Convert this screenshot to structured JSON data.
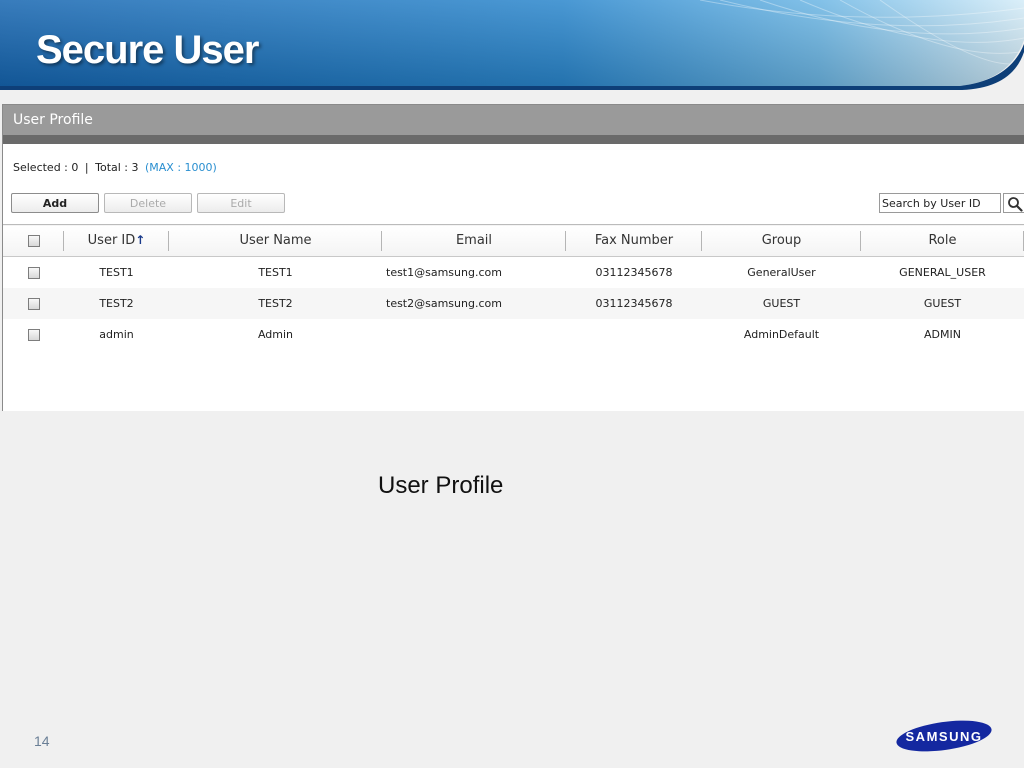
{
  "slide": {
    "title": "Secure User",
    "caption": "User Profile",
    "page_number": "14",
    "logo_text": "SAMSUNG"
  },
  "panel": {
    "title": "User Profile",
    "summary": {
      "selected": "Selected : 0",
      "separator": "|",
      "total": "Total : 3",
      "max": "(MAX : 1000)"
    },
    "buttons": {
      "add": "Add",
      "delete": "Delete",
      "edit": "Edit"
    },
    "search": {
      "placeholder": "Search by User ID",
      "icon": "search-icon"
    }
  },
  "table": {
    "headers": {
      "user_id": "User ID",
      "sort_arrow": "↑",
      "user_name": "User Name",
      "email": "Email",
      "fax": "Fax Number",
      "group": "Group",
      "role": "Role"
    },
    "rows": [
      {
        "user_id": "TEST1",
        "user_name": "TEST1",
        "email": "test1@samsung.com",
        "fax": "03112345678",
        "group": "GeneralUser",
        "role": "GENERAL_USER"
      },
      {
        "user_id": "TEST2",
        "user_name": "TEST2",
        "email": "test2@samsung.com",
        "fax": "03112345678",
        "group": "GUEST",
        "role": "GUEST"
      },
      {
        "user_id": "admin",
        "user_name": "Admin",
        "email": "",
        "fax": "",
        "group": "AdminDefault",
        "role": "ADMIN"
      }
    ]
  },
  "colors": {
    "header_blue": "#1a5fa8",
    "panel_header": "#9a9a9a",
    "max_text": "#2a8fd0",
    "logo_blue": "#1428a0"
  }
}
